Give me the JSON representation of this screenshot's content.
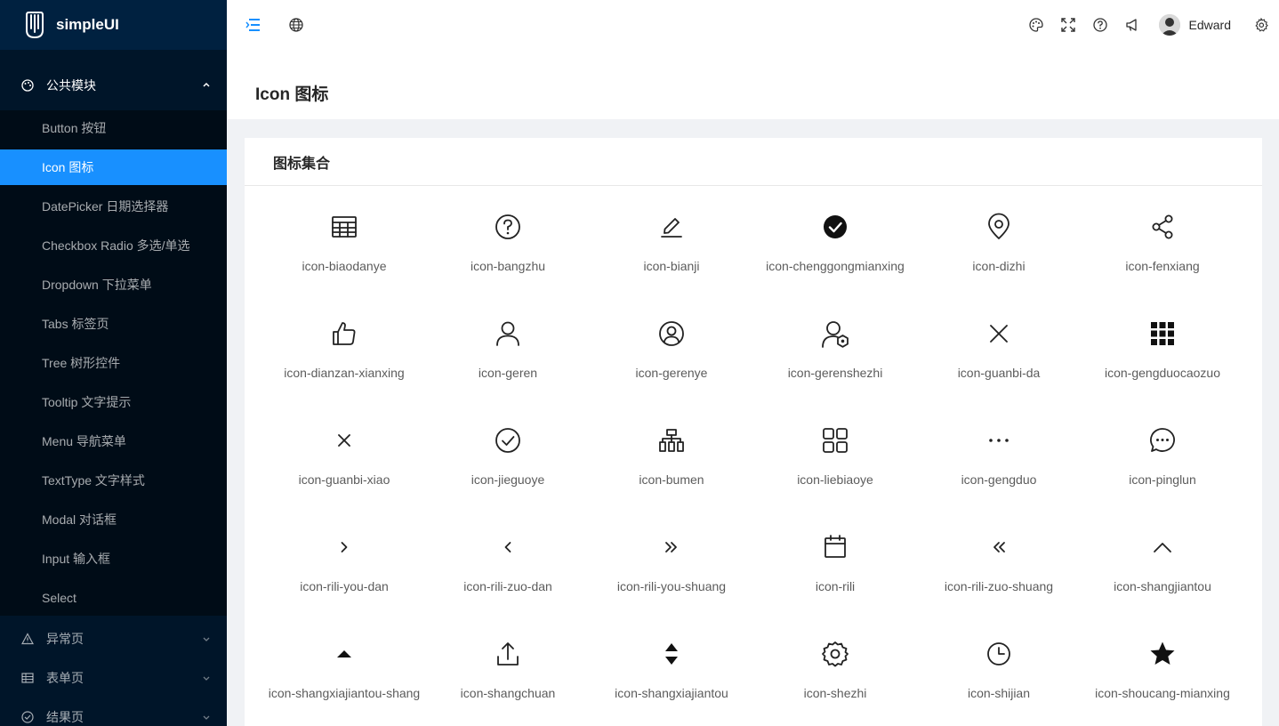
{
  "app": {
    "name": "simpleUI"
  },
  "sidebar": {
    "group_open": {
      "label": "公共模块",
      "icon": "palette-icon"
    },
    "items": [
      {
        "label": "Button 按钮"
      },
      {
        "label": "Icon 图标"
      },
      {
        "label": "DatePicker 日期选择器"
      },
      {
        "label": "Checkbox Radio 多选/单选"
      },
      {
        "label": "Dropdown 下拉菜单"
      },
      {
        "label": "Tabs 标签页"
      },
      {
        "label": "Tree 树形控件"
      },
      {
        "label": "Tooltip 文字提示"
      },
      {
        "label": "Menu 导航菜单"
      },
      {
        "label": "TextType 文字样式"
      },
      {
        "label": "Modal 对话框"
      },
      {
        "label": "Input 输入框"
      },
      {
        "label": "Select"
      }
    ],
    "active_index": 1,
    "groups_closed": [
      {
        "label": "异常页",
        "icon": "warning-icon"
      },
      {
        "label": "表单页",
        "icon": "table-icon"
      },
      {
        "label": "结果页",
        "icon": "check-circle-icon"
      }
    ]
  },
  "header": {
    "user": {
      "name": "Edward"
    },
    "icons": [
      "menu-fold-icon",
      "globe-icon",
      "theme-icon",
      "fullscreen-icon",
      "help-icon",
      "notification-icon",
      "settings-icon"
    ]
  },
  "page": {
    "title": "Icon 图标",
    "card_title": "图标集合"
  },
  "icons": [
    {
      "name": "icon-biaodanye",
      "glyph": "table"
    },
    {
      "name": "icon-bangzhu",
      "glyph": "help"
    },
    {
      "name": "icon-bianji",
      "glyph": "edit"
    },
    {
      "name": "icon-chenggongmianxing",
      "glyph": "check-filled"
    },
    {
      "name": "icon-dizhi",
      "glyph": "location"
    },
    {
      "name": "icon-fenxiang",
      "glyph": "share"
    },
    {
      "name": "icon-dianzan-xianxing",
      "glyph": "thumb"
    },
    {
      "name": "icon-geren",
      "glyph": "user"
    },
    {
      "name": "icon-gerenye",
      "glyph": "user-circle"
    },
    {
      "name": "icon-gerenshezhi",
      "glyph": "user-setting"
    },
    {
      "name": "icon-guanbi-da",
      "glyph": "close-large"
    },
    {
      "name": "icon-gengduocaozuo",
      "glyph": "grid-dots"
    },
    {
      "name": "icon-guanbi-xiao",
      "glyph": "close-small"
    },
    {
      "name": "icon-jieguoye",
      "glyph": "check-circle"
    },
    {
      "name": "icon-bumen",
      "glyph": "org"
    },
    {
      "name": "icon-liebiaoye",
      "glyph": "apps"
    },
    {
      "name": "icon-gengduo",
      "glyph": "more"
    },
    {
      "name": "icon-pinglun",
      "glyph": "comment"
    },
    {
      "name": "icon-rili-you-dan",
      "glyph": "right"
    },
    {
      "name": "icon-rili-zuo-dan",
      "glyph": "left"
    },
    {
      "name": "icon-rili-you-shuang",
      "glyph": "double-right"
    },
    {
      "name": "icon-rili",
      "glyph": "calendar"
    },
    {
      "name": "icon-rili-zuo-shuang",
      "glyph": "double-left"
    },
    {
      "name": "icon-shangjiantou",
      "glyph": "up"
    },
    {
      "name": "icon-shangxiajiantou-shang",
      "glyph": "caret-up"
    },
    {
      "name": "icon-shangchuan",
      "glyph": "upload"
    },
    {
      "name": "icon-shangxiajiantou",
      "glyph": "sort"
    },
    {
      "name": "icon-shezhi",
      "glyph": "gear"
    },
    {
      "name": "icon-shijian",
      "glyph": "clock"
    },
    {
      "name": "icon-shoucang-mianxing",
      "glyph": "star"
    }
  ]
}
